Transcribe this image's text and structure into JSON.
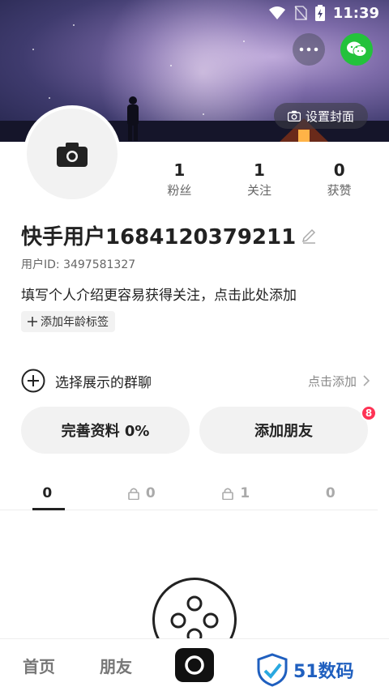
{
  "status_bar": {
    "time": "11:39"
  },
  "cover": {
    "set_cover_label": "设置封面"
  },
  "stats": [
    {
      "value": "1",
      "label": "粉丝"
    },
    {
      "value": "1",
      "label": "关注"
    },
    {
      "value": "0",
      "label": "获赞"
    }
  ],
  "profile": {
    "username": "快手用户1684120379211",
    "user_id": "用户ID: 3497581327",
    "bio_placeholder": "填写个人介绍更容易获得关注，点击此处添加",
    "add_age_tag": "添加年龄标签"
  },
  "group_chat": {
    "label": "选择展示的群聊",
    "action": "点击添加"
  },
  "actions": {
    "complete_profile": "完善资料 0%",
    "add_friends": "添加朋友",
    "add_friends_badge": "8"
  },
  "tabs": [
    {
      "count": "0",
      "locked": false
    },
    {
      "count": "0",
      "locked": true
    },
    {
      "count": "1",
      "locked": true
    },
    {
      "count": "0",
      "locked": false
    }
  ],
  "bottom_nav": {
    "home": "首页",
    "friends": "朋友"
  },
  "watermark": {
    "text": "51数码"
  },
  "colors": {
    "wechat": "#23c23b",
    "badge": "#fe3355",
    "watermark": "#1f5fbf"
  }
}
